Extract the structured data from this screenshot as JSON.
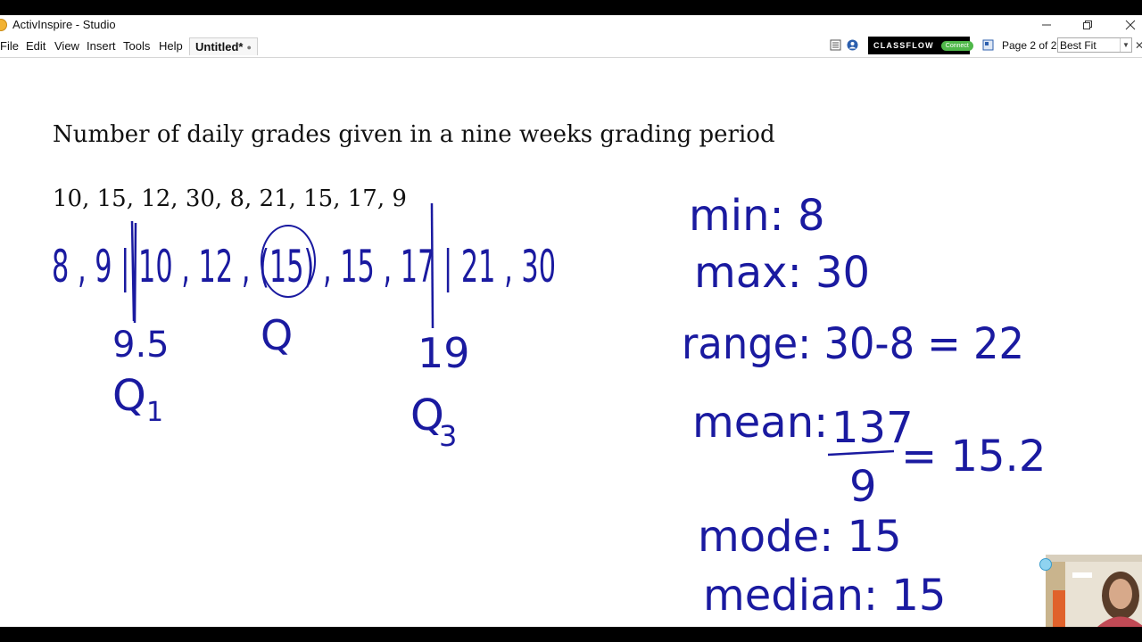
{
  "window": {
    "title": "ActivInspire - Studio",
    "minimize_icon": "minimize-icon",
    "restore_icon": "restore-icon",
    "close_icon": "close-icon"
  },
  "menu": {
    "items": [
      "File",
      "Edit",
      "View",
      "Insert",
      "Tools",
      "Help"
    ]
  },
  "tab": {
    "label": "Untitled*"
  },
  "toolbar": {
    "classflow_label": "CLASSFLOW",
    "classflow_connect": "Connect",
    "page_indicator": "Page 2 of 2",
    "zoom_value": "Best Fit"
  },
  "canvas": {
    "heading": "Number of daily grades given in a nine weeks grading period",
    "dataset": "10, 15, 12, 30, 8, 21, 15, 17, 9",
    "handwriting": {
      "sorted": "8 , 9 | 10 , 12 , (15) , 15 , 17 | 21 , 30",
      "q1_value": "9.5",
      "q1_label": "Q",
      "q1_sub": "1",
      "median_mark": "Q",
      "q3_value": "19",
      "q3_label": "Q",
      "q3_sub": "3",
      "min": "min: 8",
      "max": "max: 30",
      "range": "range: 30-8 = 22",
      "mean_label": "mean:",
      "mean_numerator": "137",
      "mean_denominator": "9",
      "mean_result": "= 15.2",
      "mode": "mode: 15",
      "median": "median: 15"
    }
  },
  "colors": {
    "ink": "#1a1aa0",
    "classflow_bg": "#000000",
    "connect_green": "#4fb84a"
  }
}
